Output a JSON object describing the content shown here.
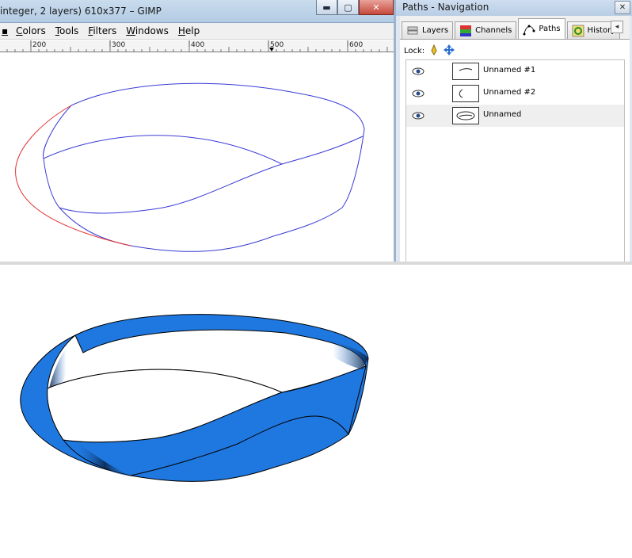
{
  "gimp_window": {
    "title": "integer, 2 layers) 610x377 – GIMP",
    "menu": [
      "Colors",
      "Tools",
      "Filters",
      "Windows",
      "Help"
    ],
    "ruler_labels": [
      "200",
      "300",
      "400",
      "500",
      "600"
    ],
    "window_buttons": {
      "minimize": "▬",
      "maximize": "▢",
      "close": "✕"
    }
  },
  "dock": {
    "title": "Paths - Navigation",
    "tabs": [
      {
        "label": "Layers",
        "icon": "layers-icon"
      },
      {
        "label": "Channels",
        "icon": "channels-icon"
      },
      {
        "label": "Paths",
        "icon": "paths-icon",
        "active": true
      },
      {
        "label": "History",
        "icon": "history-icon"
      }
    ],
    "lock_label": "Lock:",
    "paths": [
      {
        "name": "Unnamed #1",
        "visible": true,
        "selected": false
      },
      {
        "name": "Unnamed #2",
        "visible": true,
        "selected": false
      },
      {
        "name": "Unnamed",
        "visible": true,
        "selected": true
      }
    ]
  },
  "colors": {
    "path_blue": "#3b3bd6",
    "path_red": "#e03030",
    "mobius_fill": "#1f78e0"
  }
}
